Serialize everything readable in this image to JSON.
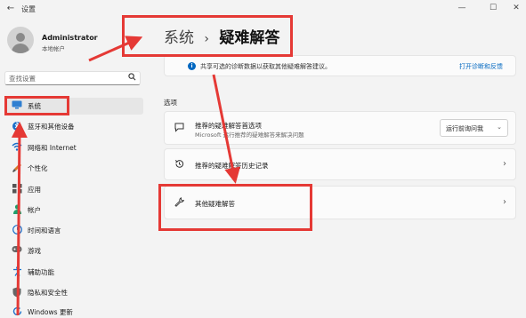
{
  "window": {
    "title": "设置",
    "back_glyph": "←",
    "minimize_glyph": "—",
    "maximize_glyph": "☐",
    "close_glyph": "✕"
  },
  "profile": {
    "name": "Administrator",
    "account_type": "本地帐户"
  },
  "search": {
    "placeholder": "查找设置",
    "icon": "search-icon"
  },
  "sidebar": {
    "items": [
      {
        "label": "系统",
        "icon": "monitor-icon",
        "active": true
      },
      {
        "label": "蓝牙和其他设备",
        "icon": "bluetooth-icon"
      },
      {
        "label": "网络和 Internet",
        "icon": "wifi-icon"
      },
      {
        "label": "个性化",
        "icon": "brush-icon"
      },
      {
        "label": "应用",
        "icon": "apps-icon"
      },
      {
        "label": "帐户",
        "icon": "person-icon"
      },
      {
        "label": "时间和语言",
        "icon": "globe-clock-icon"
      },
      {
        "label": "游戏",
        "icon": "gamepad-icon"
      },
      {
        "label": "辅助功能",
        "icon": "accessibility-icon"
      },
      {
        "label": "隐私和安全性",
        "icon": "shield-icon"
      },
      {
        "label": "Windows 更新",
        "icon": "update-icon"
      }
    ]
  },
  "header": {
    "breadcrumb_parent": "系统",
    "breadcrumb_separator": "›",
    "breadcrumb_current": "疑难解答"
  },
  "info_banner": {
    "text": "共享可选的诊断数据以获取其他疑难解答建议。",
    "link": "打开诊断和反馈"
  },
  "section": {
    "label": "选项"
  },
  "options": {
    "preferences": {
      "title": "推荐的疑难解答首选项",
      "subtitle": "Microsoft 运行推荐的疑难解答来解决问题",
      "dropdown_value": "运行前询问我"
    },
    "history": {
      "title": "推荐的疑难解答历史记录"
    },
    "other": {
      "title": "其他疑难解答"
    }
  },
  "colors": {
    "accent": "#0067c0",
    "annotation_red": "#e53935"
  }
}
